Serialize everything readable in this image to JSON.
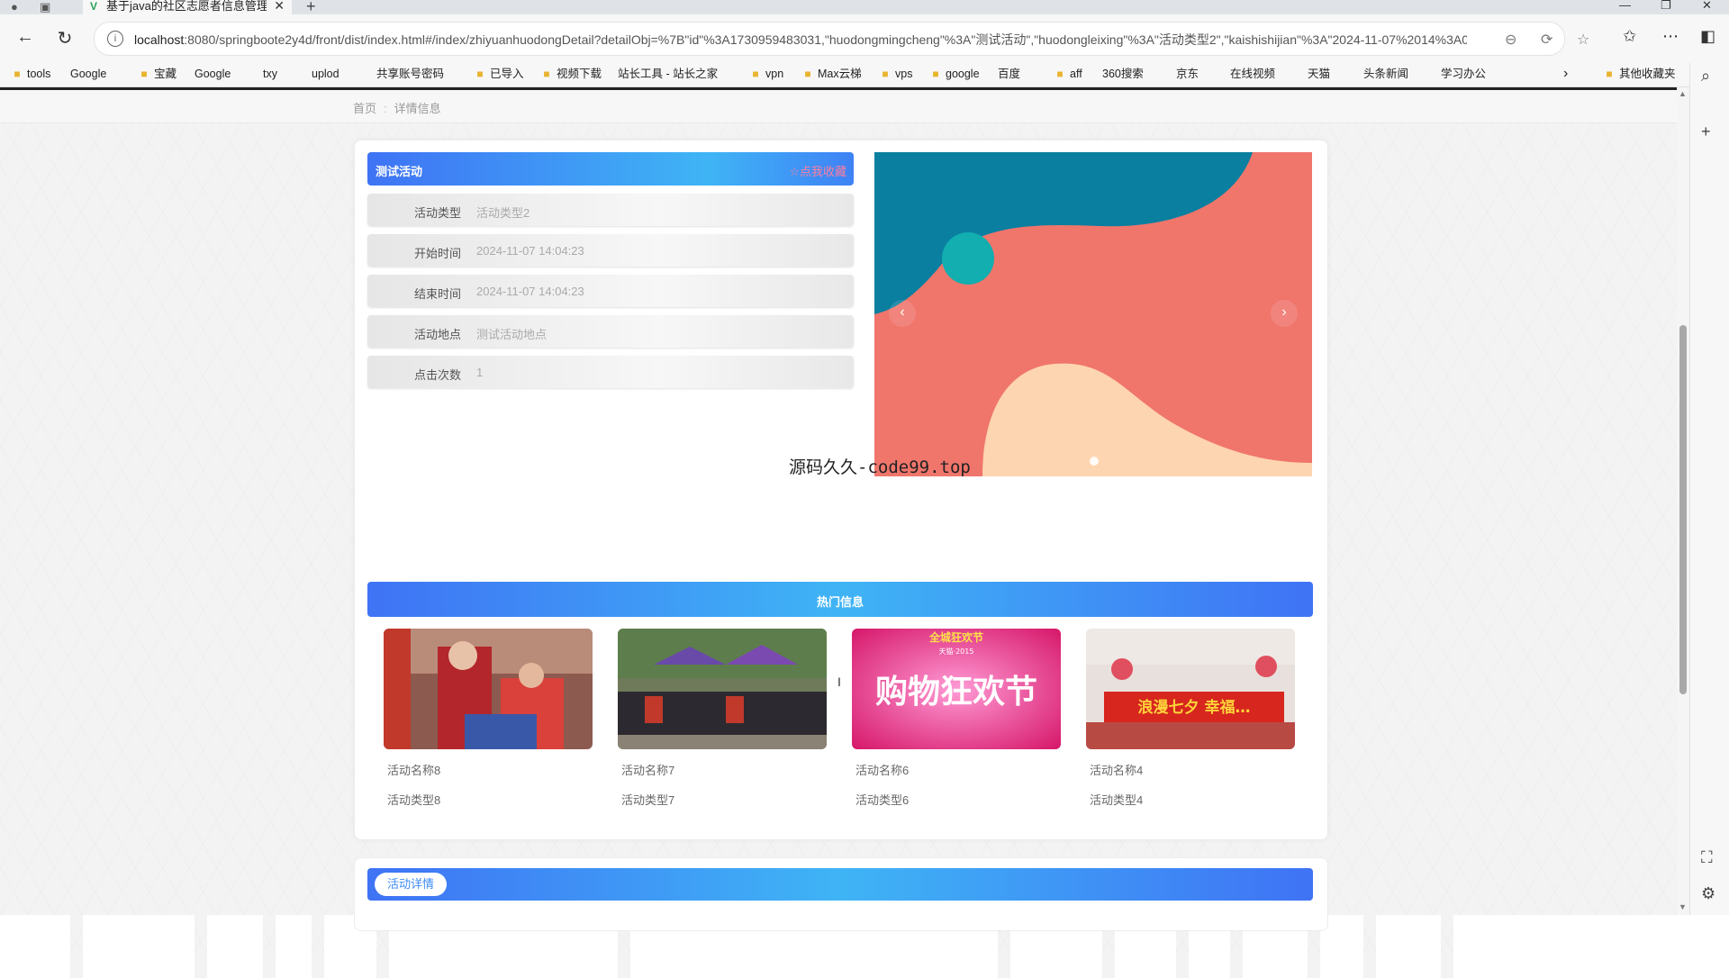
{
  "browser": {
    "tab_title": "基于java的社区志愿者信息管理系",
    "url_host": "localhost",
    "url_rest": ":8080/springboote2y4d/front/dist/index.html#/index/zhiyuanhuodongDetail?detailObj=%7B\"id\"%3A1730959483031,\"huodongmingcheng\"%3A\"测试活动\",\"huodongleixing\"%3A\"活动类型2\",\"kaishishijian\"%3A\"2024-11-07%2014%3A0...",
    "bookmarks": [
      "tools",
      "Google",
      "宝藏",
      "Google",
      "txy",
      "uplod",
      "共享账号密码",
      "已导入",
      "视频下载",
      "站长工具 - 站长之家",
      "vpn",
      "Max云梯",
      "vps",
      "google",
      "百度",
      "aff",
      "360搜索",
      "京东",
      "在线视频",
      "天猫",
      "头条新闻",
      "学习办公"
    ],
    "other_bookmarks": "其他收藏夹"
  },
  "breadcrumb": {
    "home": "首页",
    "separator": ":",
    "current": "详情信息"
  },
  "activity": {
    "title": "测试活动",
    "favorite": "☆点我收藏",
    "fields": [
      {
        "label": "活动类型",
        "value": "活动类型2"
      },
      {
        "label": "开始时间",
        "value": "2024-11-07 14:04:23"
      },
      {
        "label": "结束时间",
        "value": "2024-11-07 14:04:23"
      },
      {
        "label": "活动地点",
        "value": "测试活动地点"
      },
      {
        "label": "点击次数",
        "value": "1"
      }
    ]
  },
  "carousel": {
    "prev": "‹",
    "next": "›"
  },
  "watermark": "源码久久-code99.top",
  "hot": {
    "title": "热门信息",
    "items": [
      {
        "name": "活动名称8",
        "type": "活动类型8"
      },
      {
        "name": "活动名称7",
        "type": "活动类型7"
      },
      {
        "name": "活动名称6",
        "type": "活动类型6",
        "banner_top": "全城狂欢节",
        "banner_sub": "天猫·2015",
        "banner_main": "购物狂欢节"
      },
      {
        "name": "活动名称4",
        "type": "活动类型4",
        "banner_main": "浪漫七夕 幸福…"
      }
    ]
  },
  "details": {
    "title": "活动详情"
  },
  "colors": {
    "accent": "#3f8cf5",
    "favorite": "#ff7f9f"
  }
}
